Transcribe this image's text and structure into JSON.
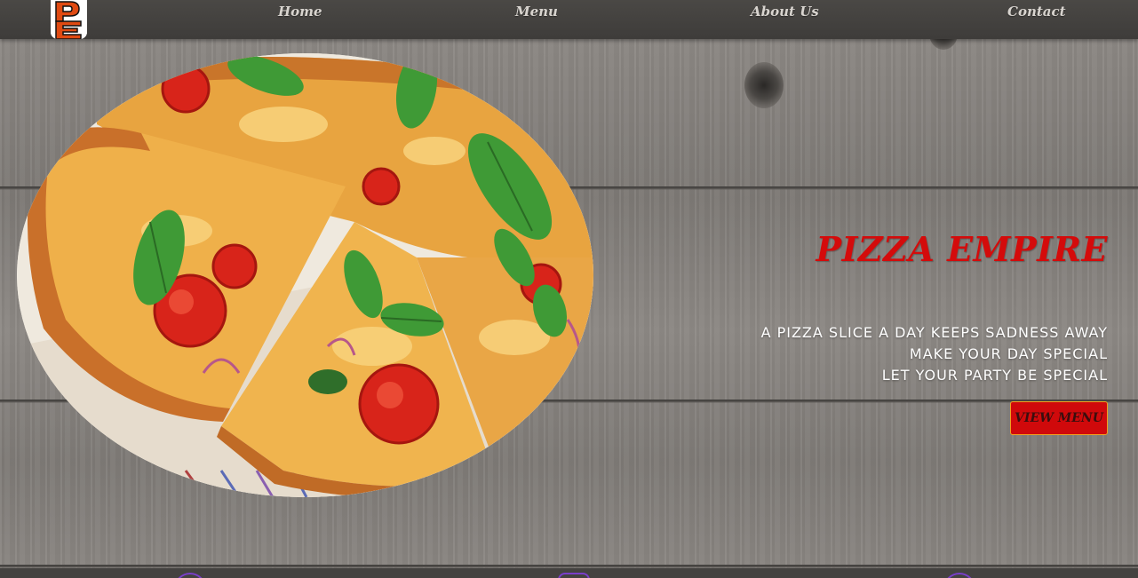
{
  "nav": {
    "logo_alt": "PE",
    "links": [
      {
        "label": "Home"
      },
      {
        "label": "Menu"
      },
      {
        "label": "About Us"
      },
      {
        "label": "Contact"
      }
    ]
  },
  "hero": {
    "title": "PIZZA EMPIRE",
    "taglines": [
      "A PIZZA SLICE A DAY KEEPS SADNESS AWAY",
      "MAKE YOUR DAY SPECIAL",
      "LET YOUR PARTY BE SPECIAL"
    ],
    "cta_label": "VIEW MENU"
  },
  "colors": {
    "accent_red": "#d40b0b",
    "button_border": "#f0a020",
    "nav_bg": "#3e3c3a",
    "wood": "#898580",
    "bottom_icon": "#7a3ec9"
  },
  "icons": {
    "logo": "pizza-empire-logo",
    "pizza_photo": "pizza-image"
  }
}
